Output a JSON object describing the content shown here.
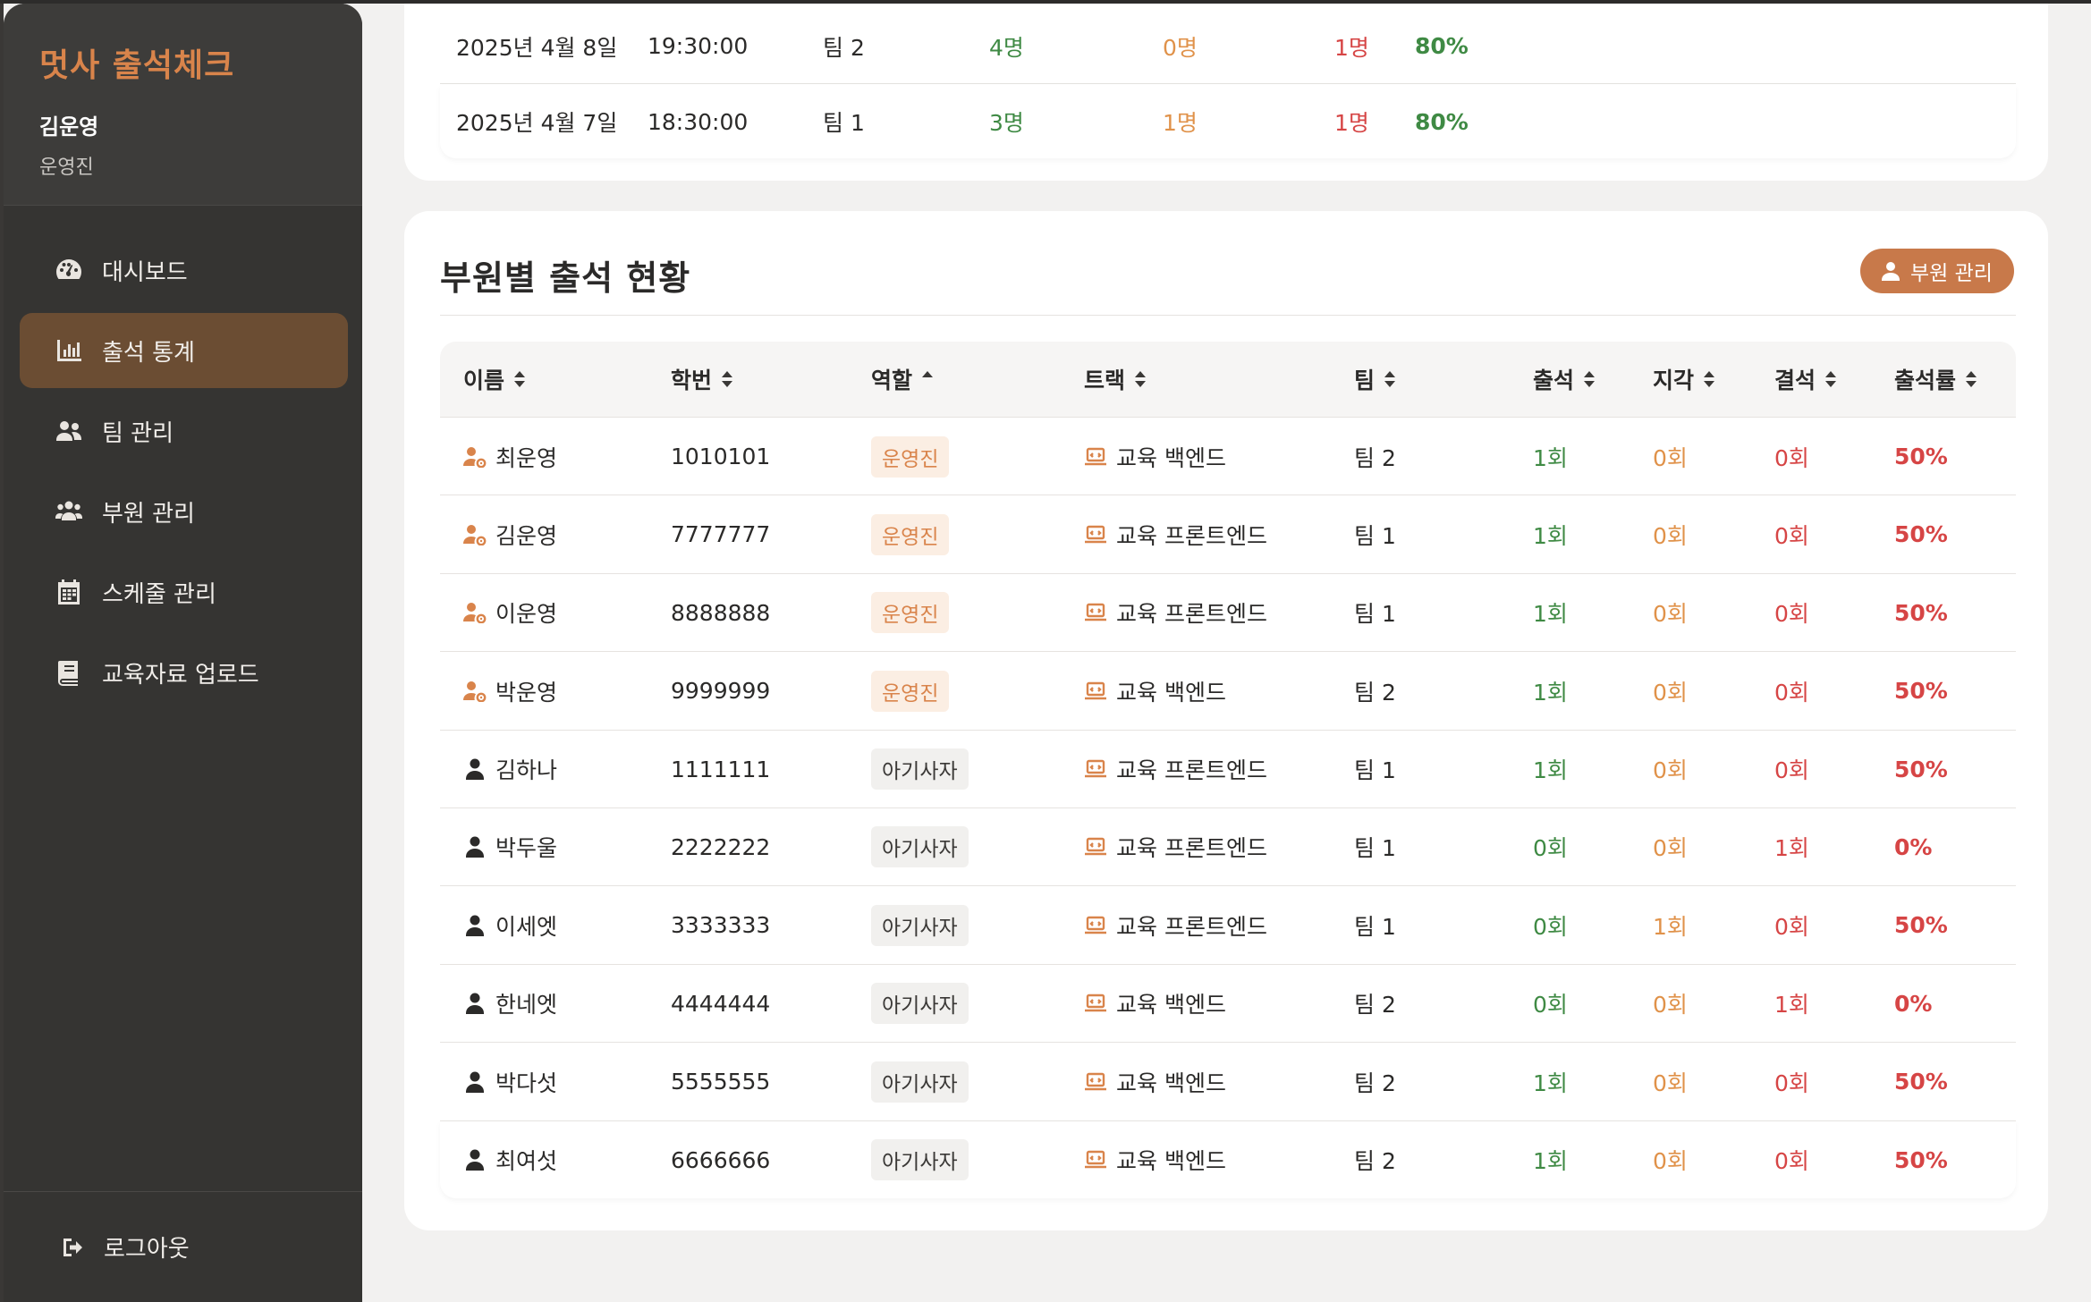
{
  "sidebar": {
    "brand": "멋사 출석체크",
    "user_name": "김운영",
    "user_role": "운영진",
    "nav": [
      {
        "label": "대시보드",
        "icon": "dashboard-icon"
      },
      {
        "label": "출석 통계",
        "icon": "chart-bar-icon",
        "active": true
      },
      {
        "label": "팀 관리",
        "icon": "users-icon"
      },
      {
        "label": "부원 관리",
        "icon": "users-group-icon"
      },
      {
        "label": "스케줄 관리",
        "icon": "calendar-icon"
      },
      {
        "label": "교육자료 업로드",
        "icon": "book-icon"
      }
    ],
    "logout": "로그아웃"
  },
  "schedule_rows": [
    {
      "date": "2025년 4월 8일",
      "time": "19:30:00",
      "team": "팀 2",
      "present": "4명",
      "late": "0명",
      "absent": "1명",
      "rate": "80%"
    },
    {
      "date": "2025년 4월 7일",
      "time": "18:30:00",
      "team": "팀 1",
      "present": "3명",
      "late": "1명",
      "absent": "1명",
      "rate": "80%"
    }
  ],
  "members_section": {
    "title": "부원별 출석 현황",
    "manage_button": "부원 관리",
    "columns": [
      "이름",
      "학번",
      "역할",
      "트랙",
      "팀",
      "출석",
      "지각",
      "결석",
      "출석률"
    ],
    "sorted_column": "역할",
    "rows": [
      {
        "name": "최운영",
        "id": "1010101",
        "role": "운영진",
        "track": "교육 백엔드",
        "team": "팀 2",
        "present": "1회",
        "late": "0회",
        "absent": "0회",
        "rate": "50%",
        "staff": true
      },
      {
        "name": "김운영",
        "id": "7777777",
        "role": "운영진",
        "track": "교육 프론트엔드",
        "team": "팀 1",
        "present": "1회",
        "late": "0회",
        "absent": "0회",
        "rate": "50%",
        "staff": true
      },
      {
        "name": "이운영",
        "id": "8888888",
        "role": "운영진",
        "track": "교육 프론트엔드",
        "team": "팀 1",
        "present": "1회",
        "late": "0회",
        "absent": "0회",
        "rate": "50%",
        "staff": true
      },
      {
        "name": "박운영",
        "id": "9999999",
        "role": "운영진",
        "track": "교육 백엔드",
        "team": "팀 2",
        "present": "1회",
        "late": "0회",
        "absent": "0회",
        "rate": "50%",
        "staff": true
      },
      {
        "name": "김하나",
        "id": "1111111",
        "role": "아기사자",
        "track": "교육 프론트엔드",
        "team": "팀 1",
        "present": "1회",
        "late": "0회",
        "absent": "0회",
        "rate": "50%",
        "staff": false
      },
      {
        "name": "박두울",
        "id": "2222222",
        "role": "아기사자",
        "track": "교육 프론트엔드",
        "team": "팀 1",
        "present": "0회",
        "late": "0회",
        "absent": "1회",
        "rate": "0%",
        "staff": false
      },
      {
        "name": "이세엣",
        "id": "3333333",
        "role": "아기사자",
        "track": "교육 프론트엔드",
        "team": "팀 1",
        "present": "0회",
        "late": "1회",
        "absent": "0회",
        "rate": "50%",
        "staff": false
      },
      {
        "name": "한네엣",
        "id": "4444444",
        "role": "아기사자",
        "track": "교육 백엔드",
        "team": "팀 2",
        "present": "0회",
        "late": "0회",
        "absent": "1회",
        "rate": "0%",
        "staff": false
      },
      {
        "name": "박다섯",
        "id": "5555555",
        "role": "아기사자",
        "track": "교육 백엔드",
        "team": "팀 2",
        "present": "1회",
        "late": "0회",
        "absent": "0회",
        "rate": "50%",
        "staff": false
      },
      {
        "name": "최여섯",
        "id": "6666666",
        "role": "아기사자",
        "track": "교육 백엔드",
        "team": "팀 2",
        "present": "1회",
        "late": "0회",
        "absent": "0회",
        "rate": "50%",
        "staff": false
      }
    ]
  },
  "colors": {
    "accent": "#d9844b",
    "sidebar": "#353432",
    "active_nav": "#6b4d33",
    "present": "#3f8a44",
    "late": "#e0924a",
    "absent": "#d64545"
  }
}
